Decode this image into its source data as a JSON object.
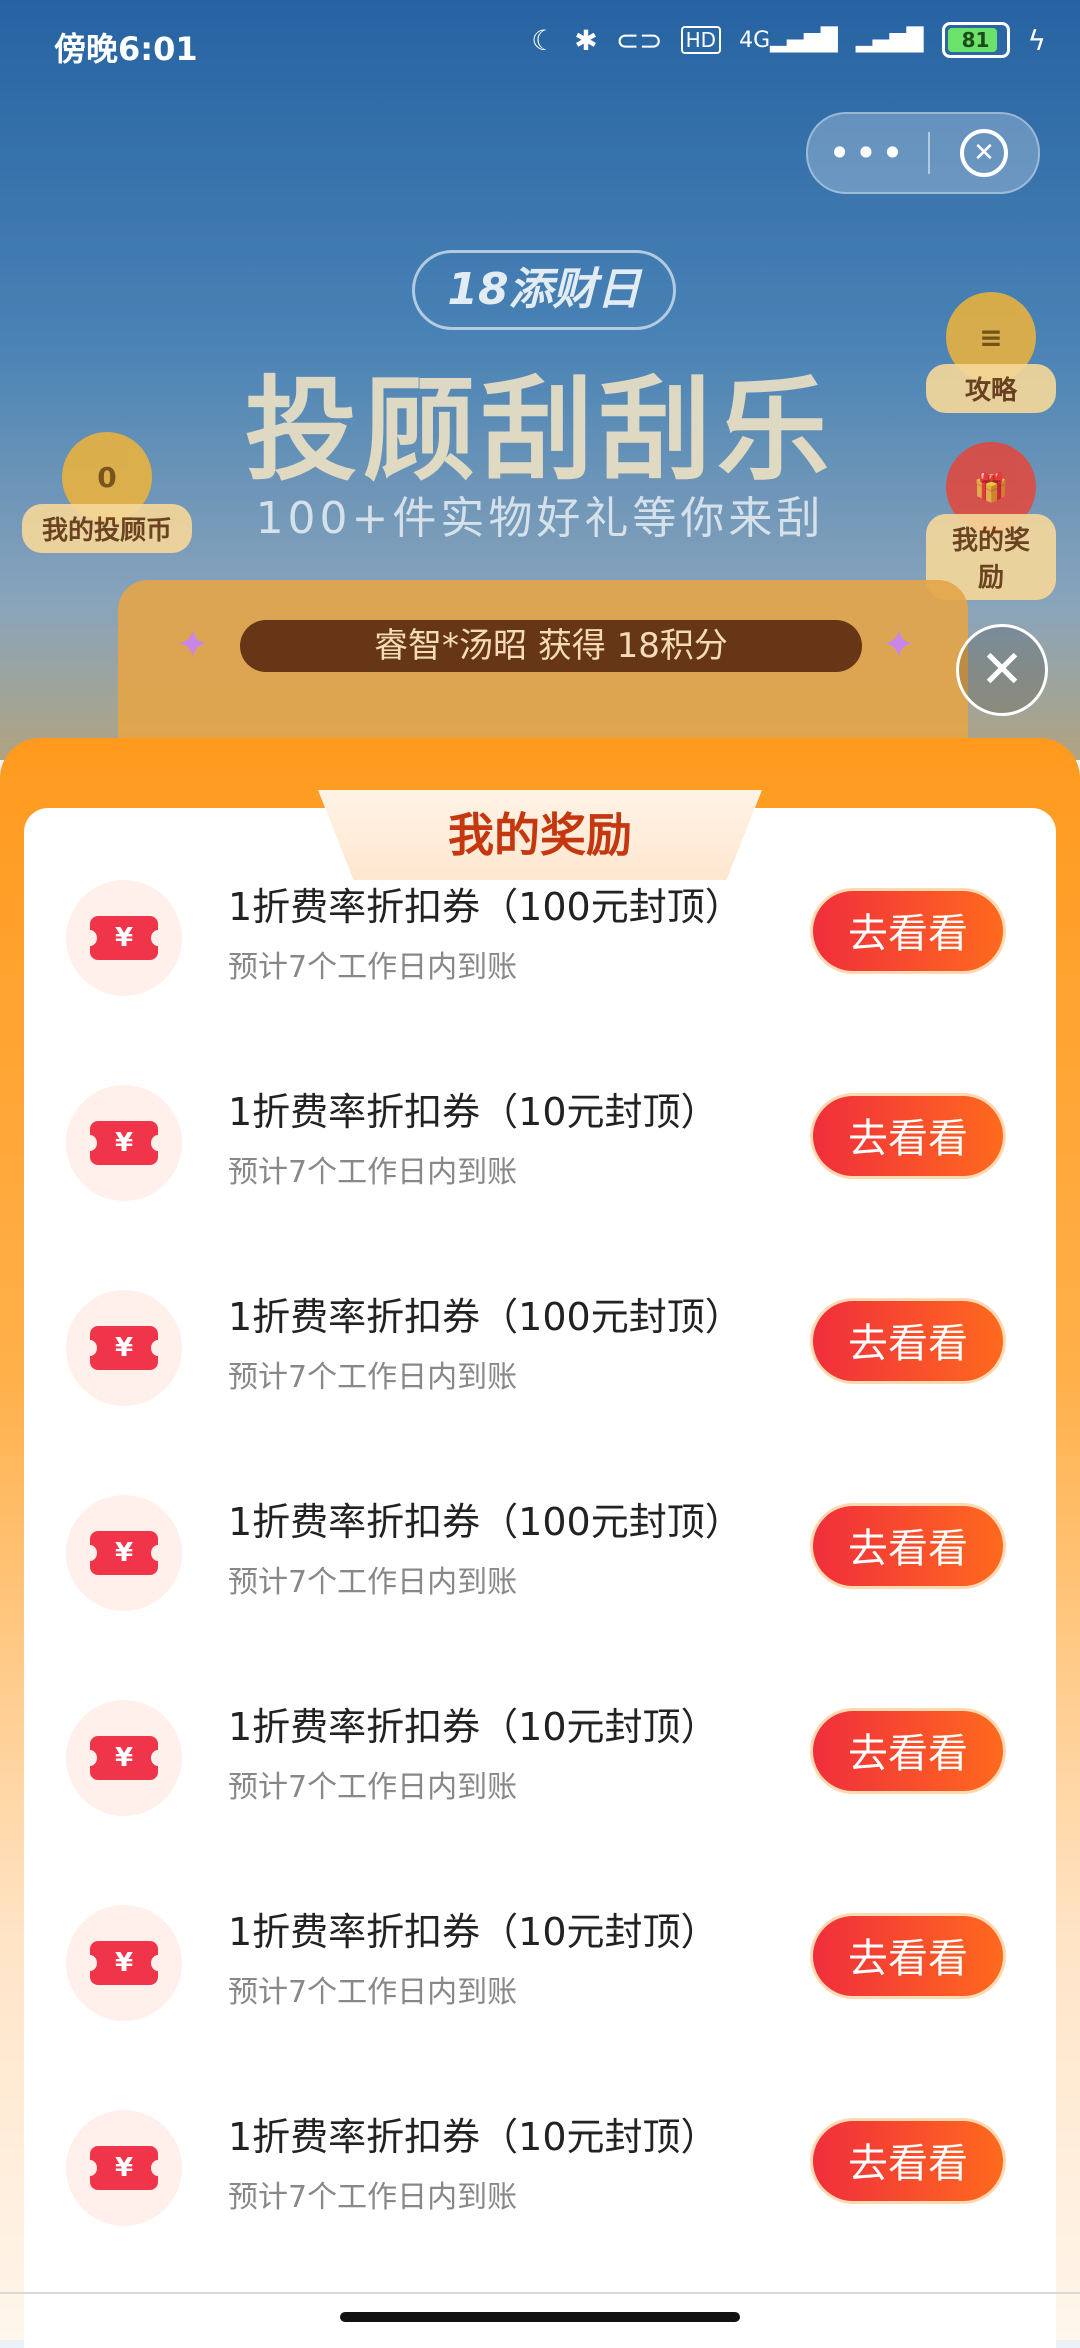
{
  "status_bar": {
    "time": "傍晚6:01",
    "icons": [
      "moon-icon",
      "bluetooth-icon",
      "link-icon",
      "hd-icon",
      "signal-4g-icon",
      "signal-icon",
      "battery-icon",
      "charging-icon"
    ],
    "network_label": "4G",
    "hd_label": "HD",
    "battery_level": "81"
  },
  "capsule": {
    "more_label": "•••"
  },
  "promo": {
    "badge": "18添财日",
    "title": "投顾刮刮乐",
    "subtitle": "100+件实物好礼等你来刮",
    "left_button": {
      "coin_count": "0",
      "label": "我的投顾币"
    },
    "right_top_button": {
      "label": "攻略"
    },
    "right_bottom_button": {
      "label": "我的奖励"
    },
    "ticker_text": "睿智*汤昭 获得 18积分"
  },
  "sheet": {
    "title": "我的奖励",
    "items": [
      {
        "title": "1折费率折扣券（100元封顶）",
        "subtitle": "预计7个工作日内到账",
        "button": "去看看",
        "icon_text": "¥"
      },
      {
        "title": "1折费率折扣券（10元封顶）",
        "subtitle": "预计7个工作日内到账",
        "button": "去看看",
        "icon_text": "¥"
      },
      {
        "title": "1折费率折扣券（100元封顶）",
        "subtitle": "预计7个工作日内到账",
        "button": "去看看",
        "icon_text": "¥"
      },
      {
        "title": "1折费率折扣券（100元封顶）",
        "subtitle": "预计7个工作日内到账",
        "button": "去看看",
        "icon_text": "¥"
      },
      {
        "title": "1折费率折扣券（10元封顶）",
        "subtitle": "预计7个工作日内到账",
        "button": "去看看",
        "icon_text": "¥"
      },
      {
        "title": "1折费率折扣券（10元封顶）",
        "subtitle": "预计7个工作日内到账",
        "button": "去看看",
        "icon_text": "¥"
      },
      {
        "title": "1折费率折扣券（10元封顶）",
        "subtitle": "预计7个工作日内到账",
        "button": "去看看",
        "icon_text": "¥"
      }
    ]
  },
  "colors": {
    "sheet_orange": "#ff9a1e",
    "button_red": "#f02e3c",
    "button_orange": "#ff6a1e",
    "title_red": "#c4370f",
    "ticket_red": "#f0344a"
  }
}
